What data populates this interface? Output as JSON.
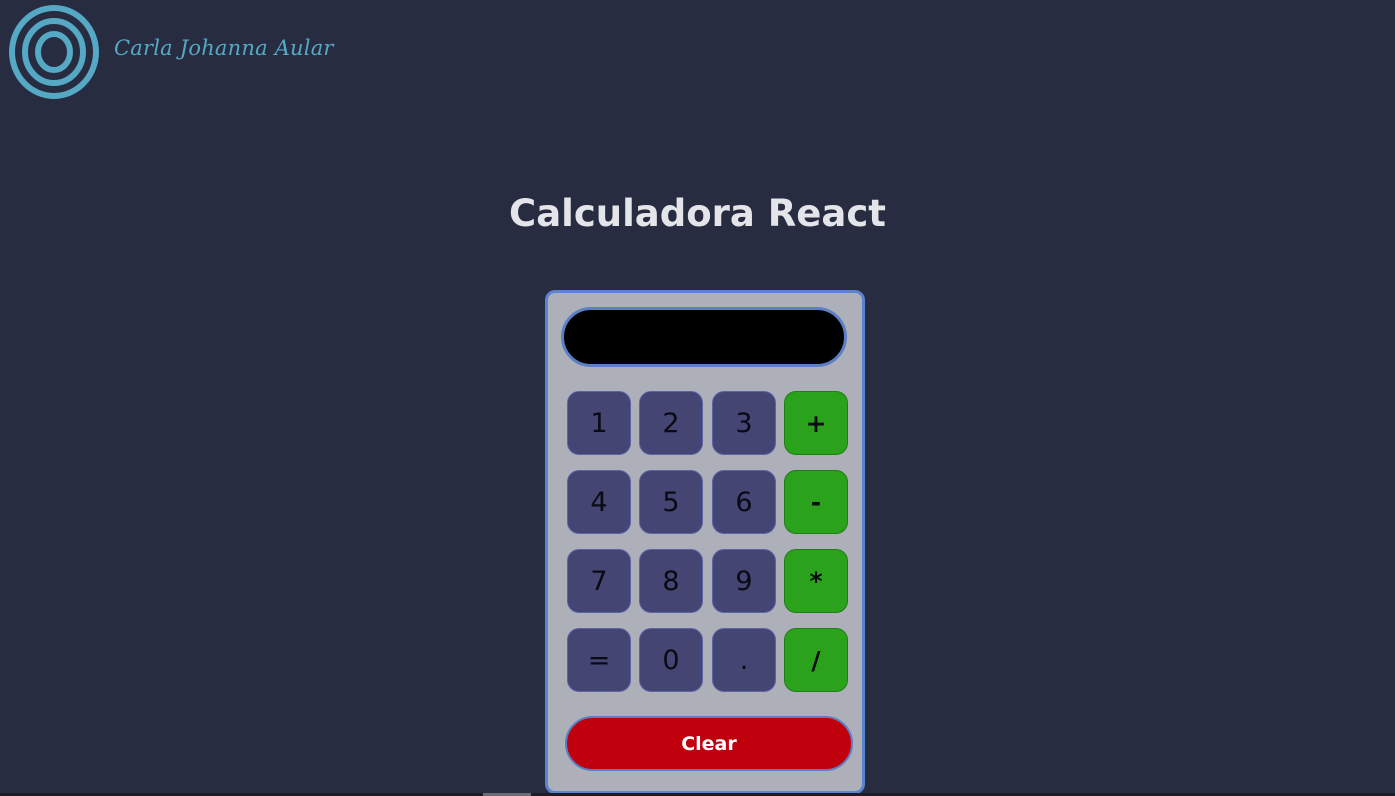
{
  "header": {
    "logo_icon": "concentric-circles-logo-icon",
    "brand_name": "Carla Johanna Aular",
    "brand_color": "#55a9c5"
  },
  "main": {
    "title": "Calculadora React"
  },
  "calculator": {
    "display_value": "",
    "keys": [
      {
        "label": "1",
        "kind": "number"
      },
      {
        "label": "2",
        "kind": "number"
      },
      {
        "label": "3",
        "kind": "number"
      },
      {
        "label": "+",
        "kind": "operator"
      },
      {
        "label": "4",
        "kind": "number"
      },
      {
        "label": "5",
        "kind": "number"
      },
      {
        "label": "6",
        "kind": "number"
      },
      {
        "label": "-",
        "kind": "operator"
      },
      {
        "label": "7",
        "kind": "number"
      },
      {
        "label": "8",
        "kind": "number"
      },
      {
        "label": "9",
        "kind": "number"
      },
      {
        "label": "*",
        "kind": "operator"
      },
      {
        "label": "=",
        "kind": "number"
      },
      {
        "label": "0",
        "kind": "number"
      },
      {
        "label": ".",
        "kind": "number"
      },
      {
        "label": "/",
        "kind": "operator"
      }
    ],
    "clear_label": "Clear"
  },
  "colors": {
    "background": "#282c41",
    "calculator_body": "#adb0b9",
    "calculator_border": "#5b83d2",
    "number_key": "#444572",
    "operator_key": "#2ba21c",
    "clear_button": "#c1000e",
    "display": "#000000"
  }
}
